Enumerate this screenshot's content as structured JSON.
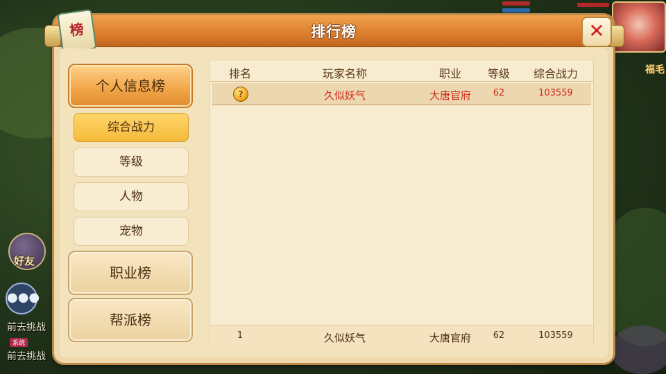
{
  "window": {
    "title": "排行榜",
    "title_icon_char": "榜",
    "close_icon": "close-x-icon"
  },
  "background": {
    "friends_label": "好友",
    "chat_icon": "chat-bubble-icon",
    "chat_lines": [
      "前去挑战",
      "前去挑战"
    ],
    "chat_tag": "系统",
    "right_text": "福毛"
  },
  "categories": [
    {
      "label": "个人信息榜",
      "active": true
    },
    {
      "label": "职业榜",
      "active": false
    },
    {
      "label": "帮派榜",
      "active": false
    }
  ],
  "sub_tabs": [
    {
      "label": "综合战力",
      "active": true
    },
    {
      "label": "等级",
      "active": false
    },
    {
      "label": "人物",
      "active": false
    },
    {
      "label": "宠物",
      "active": false
    }
  ],
  "table": {
    "columns": [
      "排名",
      "玩家名称",
      "职业",
      "等级",
      "综合战力"
    ],
    "rows": [
      {
        "rank_icon": "gold-medal-icon",
        "name": "久似妖气",
        "job": "大唐官府",
        "level": "62",
        "power": "103559"
      }
    ],
    "my_rank": {
      "rank": "1",
      "name": "久似妖气",
      "job": "大唐官府",
      "level": "62",
      "power": "103559"
    }
  },
  "colors": {
    "accent_orange": "#e08c2e",
    "highlight_text": "#d12c1c",
    "panel_bg": "#eed8ac"
  }
}
